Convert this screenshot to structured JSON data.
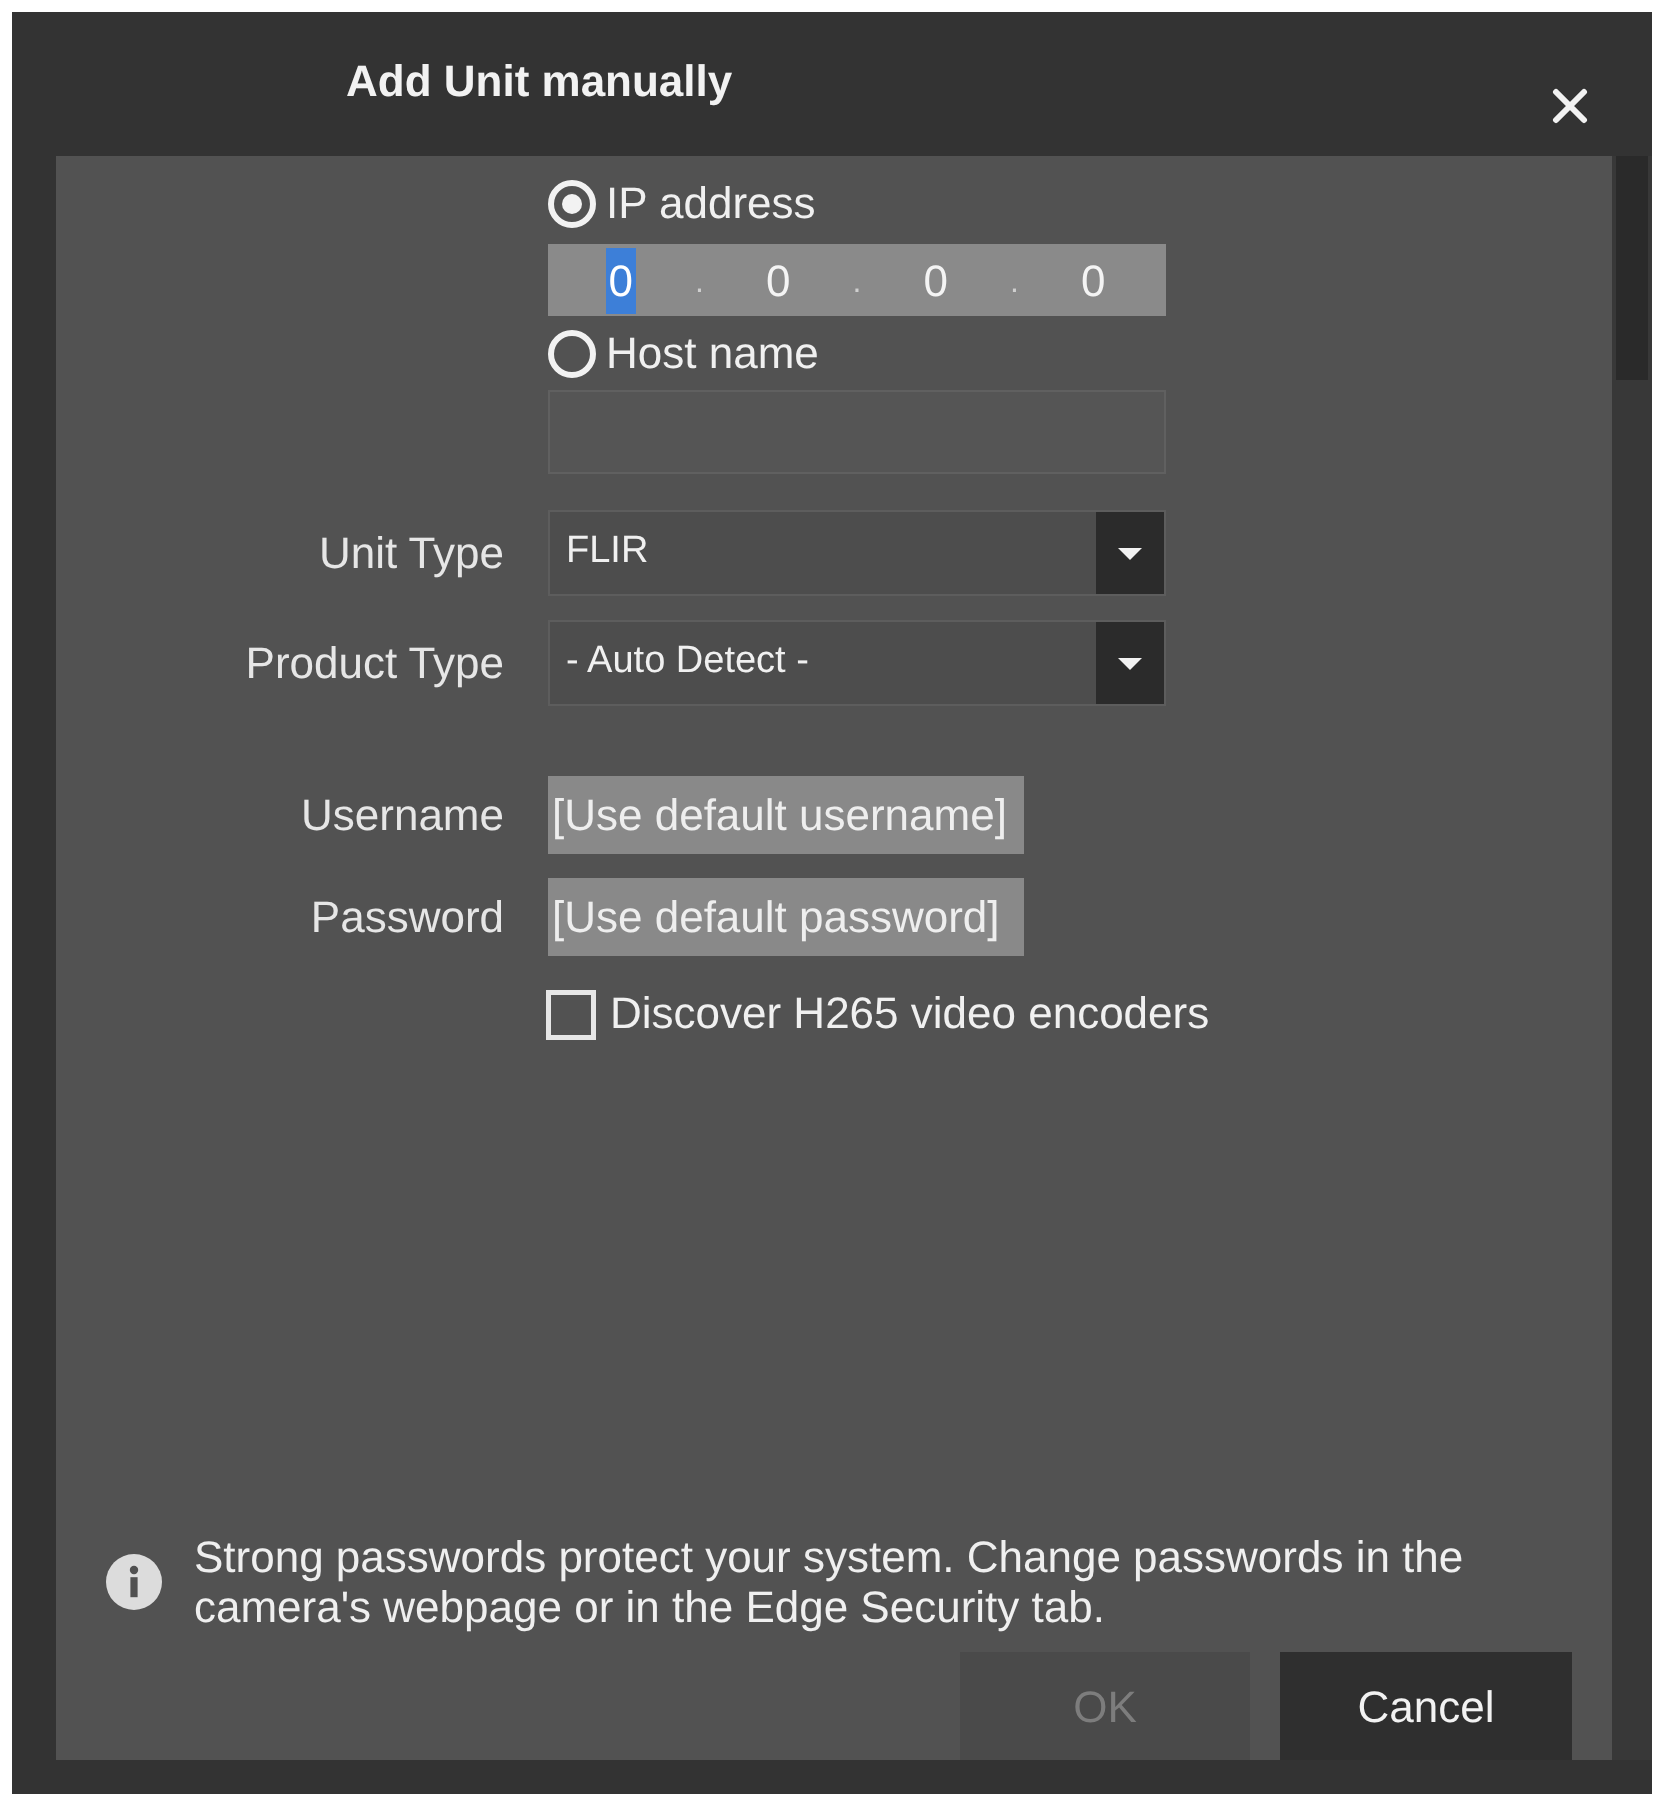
{
  "dialog": {
    "title": "Add Unit manually"
  },
  "address_mode": [
    {
      "label": "IP address",
      "selected": true
    },
    {
      "label": "Host name",
      "selected": false
    }
  ],
  "ip_address": {
    "octets": [
      {
        "value": "0",
        "selected": true
      },
      {
        "value": "0",
        "selected": false
      },
      {
        "value": "0",
        "selected": false
      },
      {
        "value": "0",
        "selected": false
      }
    ],
    "separators": [
      ".",
      ".",
      "."
    ]
  },
  "host_name": {
    "disabled": true
  },
  "fields": [
    {
      "kind": "select",
      "label": "Unit Type",
      "value": "FLIR"
    },
    {
      "kind": "select",
      "label": "Product Type",
      "value": "- Auto Detect -"
    },
    {
      "kind": "text",
      "label": "Username",
      "placeholder": "[Use default username]"
    },
    {
      "kind": "text",
      "label": "Password",
      "placeholder": "[Use default password]"
    }
  ],
  "h265_option": {
    "label": "Discover H265 video encoders",
    "checked": false
  },
  "info": {
    "text": "Strong passwords protect your system. Change passwords in the camera's webpage or in the Edge Security tab."
  },
  "buttons": [
    {
      "label": "OK",
      "disabled": true
    },
    {
      "label": "Cancel",
      "disabled": false
    }
  ]
}
